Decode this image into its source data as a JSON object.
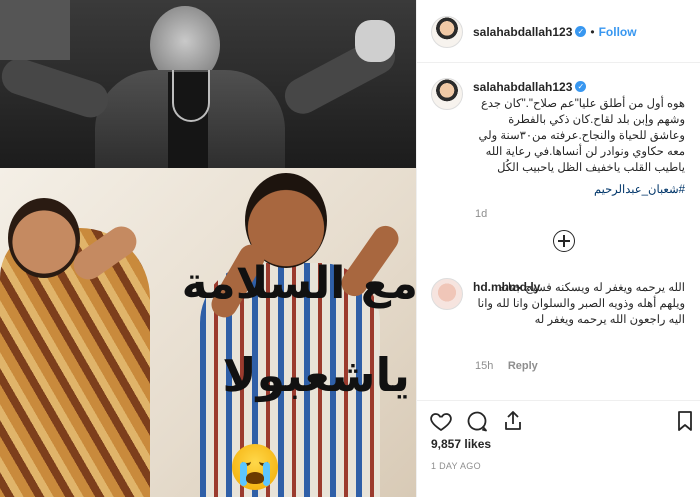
{
  "post": {
    "caption_overlay_line1": "مع السلامة",
    "caption_overlay_line2": "ياشعبولا",
    "emoji": "crying-face"
  },
  "header": {
    "username": "salahabdallah123",
    "verified": true,
    "separator": "•",
    "follow_label": "Follow"
  },
  "caption": {
    "username": "salahabdallah123",
    "text": "هوه أول من أطلق عليا\"عم صلاح\".\"كان جدع وشهم وإبن بلد لقاح.كان ذكي بالفطرة وعاشق للحياة والنجاح.عرفته من٣٠سنة ولي معه حكاوي ونوادر لن أنساها.في رعاية الله ياطيب القلب ياخفيف الظل ياحبيب الكُل",
    "hashtag": "#شعبان_عبدالرحيم",
    "time": "1d"
  },
  "comments": [
    {
      "username": "hd.mhmd.ly",
      "text": "الله يرحمه ويغفر له ويسكنه فسيح جناته ويلهم أهله وذويه الصبر والسلوان وانا لله وانا اليه راجعون الله يرحمه ويغفر له",
      "time": "15h",
      "reply_label": "Reply"
    }
  ],
  "footer": {
    "likes": "9,857 likes",
    "date": "1 DAY AGO"
  },
  "colors": {
    "link": "#3897f0",
    "text": "#262626",
    "muted": "#8e8e8e",
    "border": "#efefef"
  }
}
